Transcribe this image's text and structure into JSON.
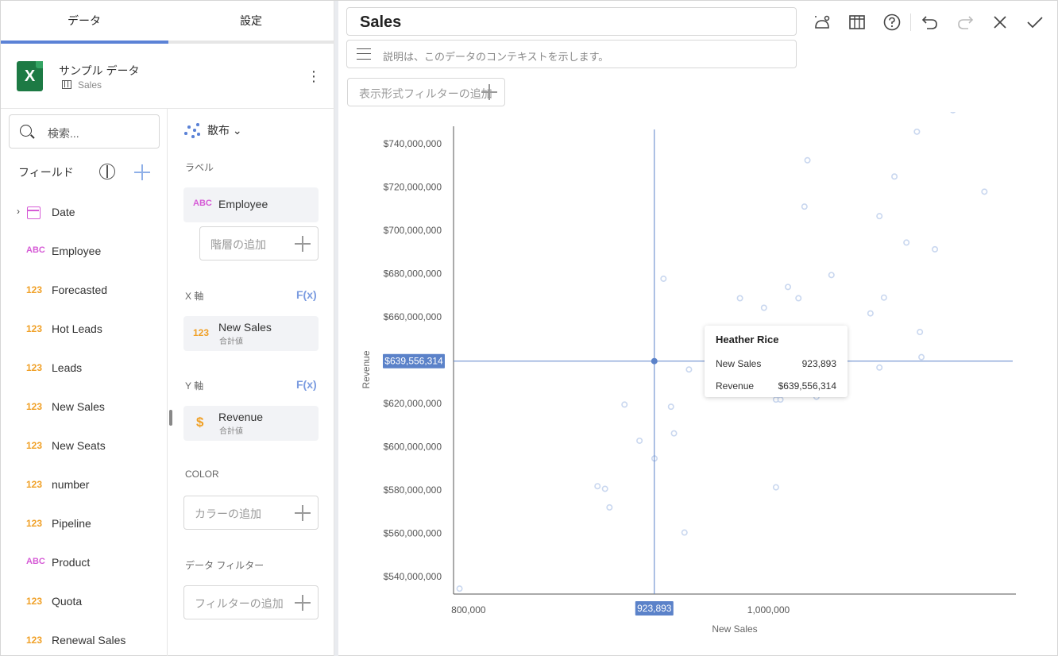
{
  "tabs": [
    {
      "label": "データ"
    },
    {
      "label": "設定"
    }
  ],
  "source": {
    "name": "サンプル データ",
    "table": "Sales",
    "icon": "excel-icon"
  },
  "fields": {
    "search_placeholder": "検索...",
    "header": "フィールド",
    "items": [
      {
        "label": "Date",
        "type": "date"
      },
      {
        "label": "Employee",
        "type": "ABC"
      },
      {
        "label": "Forecasted",
        "type": "123"
      },
      {
        "label": "Hot Leads",
        "type": "123"
      },
      {
        "label": "Leads",
        "type": "123"
      },
      {
        "label": "New Sales",
        "type": "123"
      },
      {
        "label": "New Seats",
        "type": "123"
      },
      {
        "label": "number",
        "type": "123"
      },
      {
        "label": "Pipeline",
        "type": "123"
      },
      {
        "label": "Product",
        "type": "ABC"
      },
      {
        "label": "Quota",
        "type": "123"
      },
      {
        "label": "Renewal Sales",
        "type": "123"
      }
    ]
  },
  "config": {
    "viz_type": "散布",
    "label_section": "ラベル",
    "label_field": {
      "name": "Employee",
      "type": "ABC"
    },
    "hierarchy_placeholder": "階層の追加",
    "x_section": "X 軸",
    "x_field": {
      "name": "New Sales",
      "agg": "合計値",
      "type": "123"
    },
    "y_section": "Y 軸",
    "y_field": {
      "name": "Revenue",
      "agg": "合計値",
      "type": "$"
    },
    "fx": "F(x)",
    "color_section": "COLOR",
    "color_placeholder": "カラーの追加",
    "filter_section": "データ フィルター",
    "filter_placeholder": "フィルターの追加"
  },
  "editor": {
    "title": "Sales",
    "description_placeholder": "説明は、このデータのコンテキストを示します。",
    "visual_filter_placeholder": "表示形式フィルターの追加",
    "toolbar": [
      "theme-icon",
      "table-icon",
      "help-icon",
      "undo-icon",
      "redo-icon",
      "close-icon",
      "check-icon"
    ]
  },
  "tooltip": {
    "name": "Heather Rice",
    "rows": [
      {
        "key": "New Sales",
        "value": "923,893"
      },
      {
        "key": "Revenue",
        "value": "$639,556,314"
      }
    ]
  },
  "chart_data": {
    "type": "scatter",
    "xlabel": "New Sales",
    "ylabel": "Revenue",
    "x_ticks": [
      {
        "value": 800000,
        "label": "800,000"
      },
      {
        "value": 1000000,
        "label": "1,000,000"
      }
    ],
    "y_ticks": [
      {
        "value": 540000000,
        "label": "$540,000,000"
      },
      {
        "value": 560000000,
        "label": "$560,000,000"
      },
      {
        "value": 580000000,
        "label": "$580,000,000"
      },
      {
        "value": 600000000,
        "label": "$600,000,000"
      },
      {
        "value": 620000000,
        "label": "$620,000,000"
      },
      {
        "value": 640000000,
        "label": "$640,000,000"
      },
      {
        "value": 660000000,
        "label": "$660,000,000"
      },
      {
        "value": 680000000,
        "label": "$680,000,000"
      },
      {
        "value": 700000000,
        "label": "$700,000,000"
      },
      {
        "value": 720000000,
        "label": "$720,000,000"
      },
      {
        "value": 740000000,
        "label": "$740,000,000"
      }
    ],
    "xlim": [
      790000,
      1165000
    ],
    "ylim": [
      532000000,
      748000000
    ],
    "point_color": "#c9d7ef",
    "highlight": {
      "x": 923893,
      "y": 639556314,
      "x_label": "923,893",
      "y_label": "$639,556,314"
    },
    "points": [
      [
        794000,
        534500000
      ],
      [
        886000,
        581800000
      ],
      [
        891000,
        580600000
      ],
      [
        894000,
        572000000
      ],
      [
        904000,
        619500000
      ],
      [
        914000,
        602800000
      ],
      [
        924000,
        594600000
      ],
      [
        930000,
        677600000
      ],
      [
        935000,
        618500000
      ],
      [
        937000,
        606200000
      ],
      [
        944000,
        560400000
      ],
      [
        947000,
        635700000
      ],
      [
        923893,
        639556314
      ],
      [
        981000,
        668600000
      ],
      [
        997000,
        664200000
      ],
      [
        1005000,
        621800000
      ],
      [
        1008000,
        621800000
      ],
      [
        1005000,
        581300000
      ],
      [
        1013000,
        673800000
      ],
      [
        1020000,
        668600000
      ],
      [
        1024000,
        710900000
      ],
      [
        1026000,
        732300000
      ],
      [
        1032000,
        623100000
      ],
      [
        1042000,
        679300000
      ],
      [
        1068000,
        661600000
      ],
      [
        1074000,
        636600000
      ],
      [
        1074000,
        706500000
      ],
      [
        1077000,
        668900000
      ],
      [
        1084000,
        724800000
      ],
      [
        1092000,
        694300000
      ],
      [
        1099000,
        745500000
      ],
      [
        1101000,
        653000000
      ],
      [
        1102000,
        641400000
      ],
      [
        1111000,
        691200000
      ],
      [
        1123000,
        755400000
      ],
      [
        1144000,
        717800000
      ]
    ]
  }
}
